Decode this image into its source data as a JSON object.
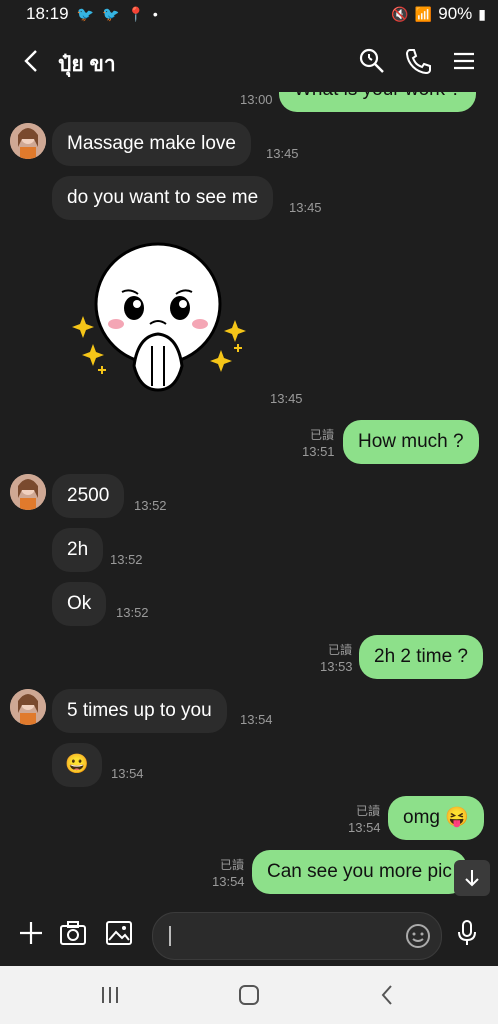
{
  "status": {
    "time": "18:19",
    "battery": "90%"
  },
  "header": {
    "contact_name": "ปุ๋ย ขา"
  },
  "messages": {
    "top_out": {
      "text": "What is your work ?",
      "time": "13:00"
    },
    "m1": {
      "text": "Massage make love",
      "time": "13:45"
    },
    "m2": {
      "text": "do you want to see me",
      "time": "13:45"
    },
    "sticker_time": "13:45",
    "m3": {
      "text": "How much ?",
      "time": "13:51",
      "read": "已讀"
    },
    "m4": {
      "text": "2500",
      "time": "13:52"
    },
    "m5": {
      "text": "2h",
      "time": "13:52"
    },
    "m6": {
      "text": "Ok",
      "time": "13:52"
    },
    "m7": {
      "text": "2h 2 time ?",
      "time": "13:53",
      "read": "已讀"
    },
    "m8": {
      "text": "5 times up to you",
      "time": "13:54"
    },
    "m9": {
      "emoji": "😀",
      "time": "13:54"
    },
    "m10": {
      "text": "omg 😝",
      "time": "13:54",
      "read": "已讀"
    },
    "m11": {
      "text": "Can see you more pic",
      "time": "13:54",
      "read": "已讀"
    }
  },
  "input": {
    "placeholder": ""
  },
  "colors": {
    "outgoing": "#8de08a",
    "incoming": "#2c2c2c",
    "background": "#1e1e1e"
  },
  "icons": [
    "back-icon",
    "search-icon",
    "phone-icon",
    "menu-icon",
    "plus-icon",
    "camera-icon",
    "image-icon",
    "emoji-icon",
    "mic-icon",
    "scroll-down-icon",
    "recents-icon",
    "home-icon",
    "nav-back-icon"
  ]
}
